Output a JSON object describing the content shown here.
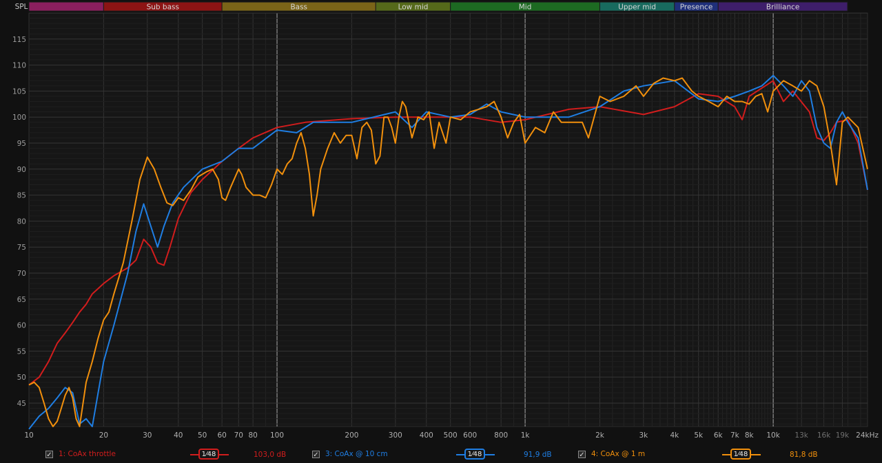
{
  "chart_data": {
    "type": "line",
    "ylabel": "SPL",
    "xscale": "log",
    "xlim": [
      10,
      24000
    ],
    "ylim": [
      40.5,
      120
    ],
    "y_ticks": [
      45,
      50,
      55,
      60,
      65,
      70,
      75,
      80,
      85,
      90,
      95,
      100,
      105,
      110,
      115
    ],
    "x_tick_values": [
      10,
      20,
      30,
      40,
      50,
      60,
      70,
      80,
      100,
      200,
      300,
      400,
      500,
      600,
      800,
      1000,
      2000,
      3000,
      4000,
      5000,
      6000,
      7000,
      8000,
      10000,
      13000,
      16000,
      19000,
      24000
    ],
    "x_tick_labels": [
      "10",
      "20",
      "30",
      "40",
      "50",
      "60",
      "70",
      "80",
      "100",
      "200",
      "300",
      "400",
      "500",
      "600",
      "800",
      "1k",
      "2k",
      "3k",
      "4k",
      "5k",
      "6k",
      "7k",
      "8k",
      "10k",
      "13k",
      "16k",
      "19k",
      "24kHz"
    ],
    "bands": [
      {
        "label": "",
        "from": 10,
        "to": 20,
        "color": "#8a1f5e"
      },
      {
        "label": "Sub bass",
        "from": 20,
        "to": 60,
        "color": "#8c1414"
      },
      {
        "label": "Bass",
        "from": 60,
        "to": 250,
        "color": "#7a6418"
      },
      {
        "label": "Low mid",
        "from": 250,
        "to": 500,
        "color": "#55691a"
      },
      {
        "label": "Mid",
        "from": 500,
        "to": 2000,
        "color": "#1d6a22"
      },
      {
        "label": "Upper mid",
        "from": 2000,
        "to": 4000,
        "color": "#186a5e"
      },
      {
        "label": "Presence",
        "from": 4000,
        "to": 6000,
        "color": "#1f2f7a"
      },
      {
        "label": "Brilliance",
        "from": 6000,
        "to": 20000,
        "color": "#3e1e6a"
      }
    ],
    "series": [
      {
        "name": "1: CoAx throttle",
        "color": "#d21d1d",
        "points": [
          [
            10,
            48.5
          ],
          [
            11,
            50
          ],
          [
            12,
            53
          ],
          [
            13,
            56.5
          ],
          [
            14,
            58.5
          ],
          [
            15,
            60.5
          ],
          [
            16,
            62.5
          ],
          [
            17,
            64
          ],
          [
            18,
            66
          ],
          [
            20,
            68
          ],
          [
            22,
            69.5
          ],
          [
            25,
            71
          ],
          [
            27,
            72.5
          ],
          [
            29,
            76.5
          ],
          [
            31,
            75
          ],
          [
            33,
            72
          ],
          [
            35,
            71.5
          ],
          [
            37,
            75
          ],
          [
            40,
            80.5
          ],
          [
            45,
            85.5
          ],
          [
            50,
            88
          ],
          [
            60,
            91.5
          ],
          [
            70,
            94
          ],
          [
            80,
            96
          ],
          [
            100,
            98
          ],
          [
            130,
            99
          ],
          [
            200,
            99.7
          ],
          [
            300,
            100
          ],
          [
            400,
            100
          ],
          [
            600,
            100
          ],
          [
            800,
            99
          ],
          [
            1000,
            99.5
          ],
          [
            1500,
            101.5
          ],
          [
            2000,
            102
          ],
          [
            3000,
            100.5
          ],
          [
            4000,
            102
          ],
          [
            5000,
            104.5
          ],
          [
            6000,
            104
          ],
          [
            7000,
            102
          ],
          [
            7500,
            99.5
          ],
          [
            8000,
            104
          ],
          [
            10000,
            107
          ],
          [
            11000,
            103
          ],
          [
            12000,
            105
          ],
          [
            14000,
            101
          ],
          [
            15000,
            96
          ],
          [
            16000,
            95.5
          ],
          [
            17000,
            97
          ],
          [
            18000,
            99
          ],
          [
            20000,
            99.5
          ],
          [
            22000,
            95
          ],
          [
            24000,
            86
          ]
        ]
      },
      {
        "name": "3: CoAx @ 10 cm",
        "color": "#1f7ee3",
        "points": [
          [
            10,
            40
          ],
          [
            11,
            42.5
          ],
          [
            12,
            44
          ],
          [
            13,
            46
          ],
          [
            14,
            48
          ],
          [
            15,
            47
          ],
          [
            16,
            41
          ],
          [
            17,
            42
          ],
          [
            18,
            40.5
          ],
          [
            19,
            47
          ],
          [
            20,
            53
          ],
          [
            22,
            60
          ],
          [
            25,
            70
          ],
          [
            27,
            78
          ],
          [
            29,
            83.3
          ],
          [
            31,
            79
          ],
          [
            33,
            75
          ],
          [
            35,
            79
          ],
          [
            38,
            83.5
          ],
          [
            42,
            86.5
          ],
          [
            50,
            90
          ],
          [
            60,
            91.5
          ],
          [
            70,
            94
          ],
          [
            80,
            94
          ],
          [
            100,
            97.5
          ],
          [
            120,
            97
          ],
          [
            140,
            99
          ],
          [
            200,
            99
          ],
          [
            300,
            101
          ],
          [
            350,
            98
          ],
          [
            400,
            101
          ],
          [
            500,
            100
          ],
          [
            600,
            100.5
          ],
          [
            700,
            102.5
          ],
          [
            800,
            101
          ],
          [
            1000,
            100
          ],
          [
            1500,
            100
          ],
          [
            2000,
            102
          ],
          [
            2500,
            105
          ],
          [
            3000,
            106
          ],
          [
            4000,
            107
          ],
          [
            5000,
            103.5
          ],
          [
            6000,
            103
          ],
          [
            7000,
            104
          ],
          [
            8000,
            105
          ],
          [
            9000,
            106
          ],
          [
            10000,
            108
          ],
          [
            11000,
            106
          ],
          [
            12000,
            104
          ],
          [
            13000,
            107
          ],
          [
            14000,
            105
          ],
          [
            15000,
            98
          ],
          [
            16000,
            95
          ],
          [
            17000,
            94
          ],
          [
            18000,
            99
          ],
          [
            19000,
            101
          ],
          [
            20000,
            99
          ],
          [
            22000,
            96
          ],
          [
            24000,
            86
          ]
        ]
      },
      {
        "name": "4: CoAx @ 1 m",
        "color": "#f2900c",
        "points": [
          [
            10,
            48.5
          ],
          [
            10.5,
            49
          ],
          [
            11,
            48
          ],
          [
            11.5,
            45
          ],
          [
            12,
            42
          ],
          [
            12.5,
            40.5
          ],
          [
            13,
            41.5
          ],
          [
            13.5,
            44
          ],
          [
            14,
            46.5
          ],
          [
            14.5,
            48
          ],
          [
            15,
            46
          ],
          [
            15.5,
            42
          ],
          [
            16,
            40.5
          ],
          [
            17,
            49
          ],
          [
            18,
            53
          ],
          [
            19,
            57.5
          ],
          [
            20,
            61
          ],
          [
            21,
            62.5
          ],
          [
            22,
            66
          ],
          [
            24,
            72
          ],
          [
            26,
            80
          ],
          [
            28,
            88
          ],
          [
            30,
            92.3
          ],
          [
            32,
            90
          ],
          [
            34,
            86.5
          ],
          [
            36,
            83.5
          ],
          [
            38,
            83
          ],
          [
            40,
            84.5
          ],
          [
            42,
            84
          ],
          [
            45,
            86
          ],
          [
            48,
            88.5
          ],
          [
            52,
            89.5
          ],
          [
            55,
            90
          ],
          [
            58,
            88
          ],
          [
            60,
            84.5
          ],
          [
            62,
            84
          ],
          [
            65,
            86.5
          ],
          [
            70,
            90
          ],
          [
            72,
            89
          ],
          [
            75,
            86.5
          ],
          [
            80,
            85
          ],
          [
            85,
            85
          ],
          [
            90,
            84.5
          ],
          [
            95,
            87
          ],
          [
            100,
            90
          ],
          [
            105,
            89
          ],
          [
            110,
            91
          ],
          [
            115,
            92
          ],
          [
            120,
            95
          ],
          [
            125,
            97
          ],
          [
            130,
            94
          ],
          [
            135,
            89
          ],
          [
            140,
            81
          ],
          [
            145,
            85
          ],
          [
            150,
            90
          ],
          [
            160,
            94
          ],
          [
            170,
            97
          ],
          [
            180,
            95
          ],
          [
            190,
            96.5
          ],
          [
            200,
            96.5
          ],
          [
            210,
            92
          ],
          [
            220,
            98
          ],
          [
            230,
            99
          ],
          [
            240,
            97.5
          ],
          [
            250,
            91
          ],
          [
            260,
            92.5
          ],
          [
            270,
            100
          ],
          [
            280,
            100
          ],
          [
            290,
            98
          ],
          [
            300,
            95
          ],
          [
            310,
            100
          ],
          [
            320,
            103
          ],
          [
            330,
            102
          ],
          [
            350,
            96
          ],
          [
            370,
            100
          ],
          [
            390,
            99.5
          ],
          [
            410,
            101
          ],
          [
            430,
            94
          ],
          [
            450,
            99
          ],
          [
            480,
            95
          ],
          [
            500,
            100
          ],
          [
            550,
            99.5
          ],
          [
            600,
            101
          ],
          [
            650,
            101.5
          ],
          [
            700,
            102
          ],
          [
            750,
            103
          ],
          [
            800,
            100
          ],
          [
            850,
            96
          ],
          [
            900,
            99
          ],
          [
            950,
            100.5
          ],
          [
            1000,
            95
          ],
          [
            1100,
            98
          ],
          [
            1200,
            97
          ],
          [
            1300,
            101
          ],
          [
            1400,
            99
          ],
          [
            1500,
            99
          ],
          [
            1700,
            99
          ],
          [
            1800,
            96
          ],
          [
            2000,
            104
          ],
          [
            2200,
            103
          ],
          [
            2500,
            104
          ],
          [
            2800,
            106
          ],
          [
            3000,
            104
          ],
          [
            3300,
            106.5
          ],
          [
            3600,
            107.5
          ],
          [
            4000,
            107
          ],
          [
            4300,
            107.5
          ],
          [
            4700,
            105
          ],
          [
            5000,
            104
          ],
          [
            5500,
            103
          ],
          [
            6000,
            102
          ],
          [
            6500,
            104
          ],
          [
            7000,
            103
          ],
          [
            7500,
            103
          ],
          [
            8000,
            102.5
          ],
          [
            8500,
            104
          ],
          [
            9000,
            104.5
          ],
          [
            9500,
            101
          ],
          [
            10000,
            105
          ],
          [
            10500,
            106
          ],
          [
            11000,
            107
          ],
          [
            12000,
            106
          ],
          [
            13000,
            105
          ],
          [
            14000,
            107
          ],
          [
            15000,
            106
          ],
          [
            16000,
            102
          ],
          [
            17000,
            95
          ],
          [
            18000,
            87
          ],
          [
            19000,
            99
          ],
          [
            20000,
            100
          ],
          [
            22000,
            98
          ],
          [
            24000,
            90
          ]
        ]
      }
    ]
  },
  "legend": {
    "items": [
      {
        "checked": "✓",
        "name": "1: CoAx throttle",
        "smoothing": "1⁄48",
        "level": "103,0 dB",
        "color": "#d21d1d"
      },
      {
        "checked": "✓",
        "name": "3: CoAx @ 10 cm",
        "smoothing": "1⁄48",
        "level": "91,9 dB",
        "color": "#1f7ee3"
      },
      {
        "checked": "✓",
        "name": "4: CoAx @ 1 m",
        "smoothing": "1⁄48",
        "level": "81,8 dB",
        "color": "#f2900c"
      }
    ]
  }
}
